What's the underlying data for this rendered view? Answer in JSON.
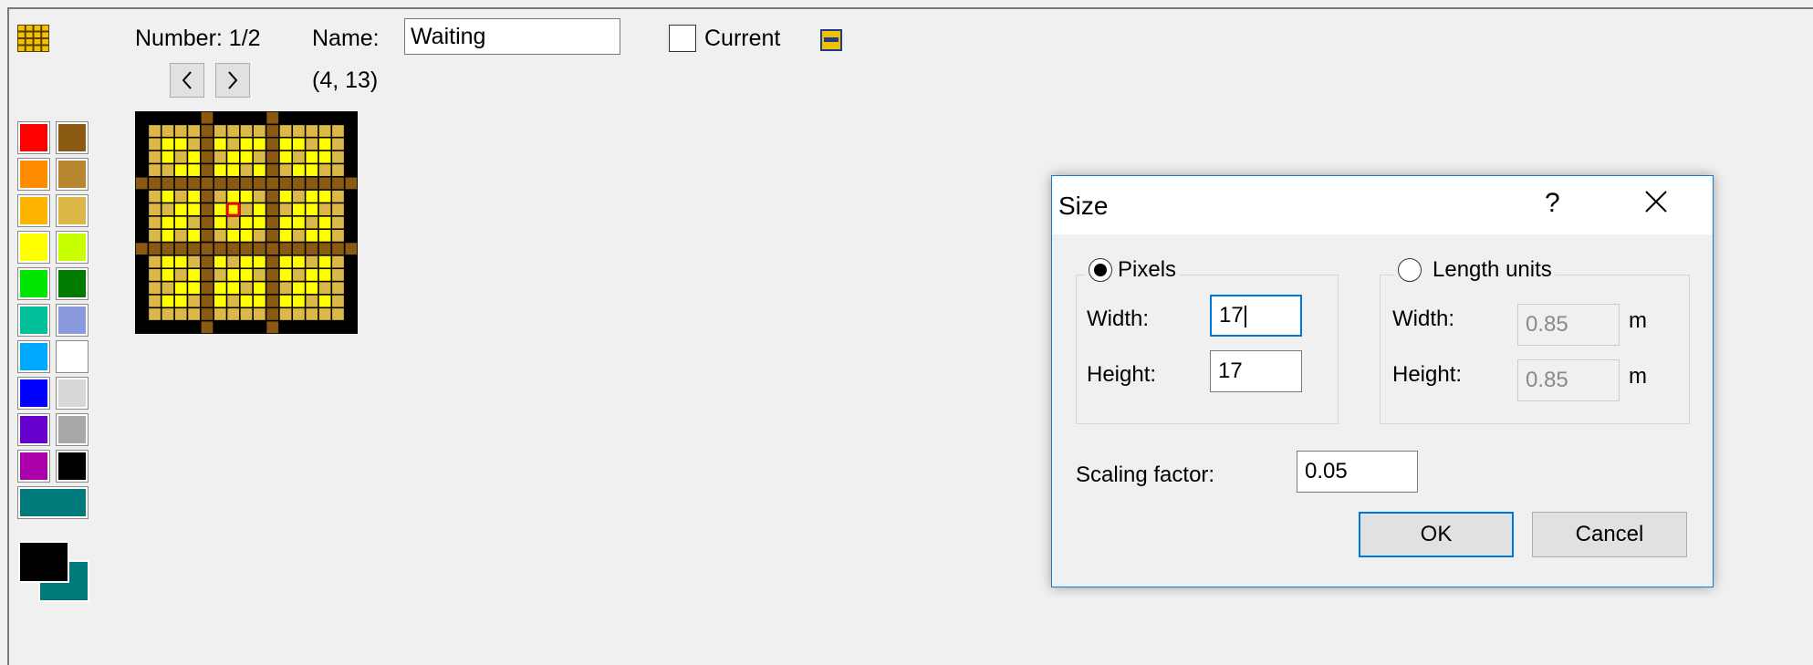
{
  "toolbar": {
    "number_label": "Number: 1/2",
    "name_label": "Name:",
    "name_value": "Waiting",
    "coords": "(4, 13)",
    "current_label": "Current",
    "current_checked": false
  },
  "palette": {
    "swatches": [
      "#ff0000",
      "#8a5a12",
      "#ff8c00",
      "#b8862f",
      "#ffb400",
      "#dcb848",
      "#ffff00",
      "#c8ff00",
      "#00e600",
      "#007a00",
      "#00c09a",
      "#8899dd",
      "#00aaff",
      "#ffffff",
      "#0000ff",
      "#d8d8d8",
      "#6600cc",
      "#a8a8a8",
      "#aa00aa",
      "#000000"
    ],
    "wide_swatch": "#007a7a",
    "foreground": "#000000",
    "background": "#007a7a"
  },
  "dialog": {
    "title": "Size",
    "help": "?",
    "pixels_group": {
      "label": "Pixels",
      "selected": true,
      "width_label": "Width:",
      "width_value": "17",
      "height_label": "Height:",
      "height_value": "17"
    },
    "length_group": {
      "label": "Length units",
      "selected": false,
      "width_label": "Width:",
      "width_value": "0.85",
      "width_unit": "m",
      "height_label": "Height:",
      "height_value": "0.85",
      "height_unit": "m"
    },
    "scaling_label": "Scaling factor:",
    "scaling_value": "0.05",
    "ok_label": "OK",
    "cancel_label": "Cancel"
  }
}
